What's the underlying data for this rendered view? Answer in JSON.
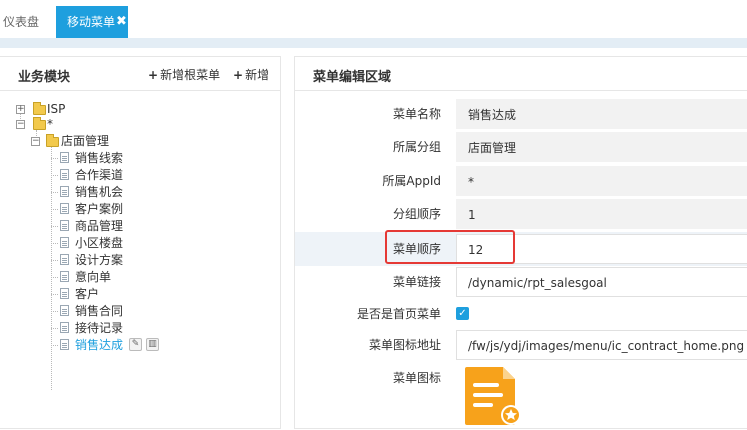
{
  "tabs": [
    {
      "label": "仪表盘",
      "active": false
    },
    {
      "label": "移动菜单",
      "active": true,
      "close": "✖"
    }
  ],
  "left_panel": {
    "title": "业务模块",
    "buttons": [
      {
        "icon": "+",
        "label": "新增根菜单"
      },
      {
        "icon": "+",
        "label": "新增"
      }
    ],
    "tree": {
      "toggle_collapsed": "+",
      "toggle_expanded": "−",
      "root_items": [
        "ISP",
        "*"
      ],
      "folder": "店面管理",
      "children": [
        "销售线索",
        "合作渠道",
        "销售机会",
        "客户案例",
        "商品管理",
        "小区楼盘",
        "设计方案",
        "意向单",
        "客户",
        "销售合同",
        "接待记录",
        "销售达成"
      ],
      "selected": "销售达成"
    }
  },
  "right_panel": {
    "title": "菜单编辑区域",
    "fields": [
      {
        "label": "菜单名称",
        "value": "销售达成"
      },
      {
        "label": "所属分组",
        "value": "店面管理"
      },
      {
        "label": "所属AppId",
        "value": "*"
      },
      {
        "label": "分组顺序",
        "value": "1"
      },
      {
        "label": "菜单顺序",
        "value": "12"
      },
      {
        "label": "菜单链接",
        "value": "/dynamic/rpt_salesgoal"
      }
    ],
    "homepage": {
      "label": "是否是首页菜单",
      "checked": true,
      "check_mark": "✓"
    },
    "icon_url": {
      "label": "菜单图标地址",
      "value": "/fw/js/ydj/images/menu/ic_contract_home.png"
    },
    "icon_label": "菜单图标"
  },
  "colors": {
    "accent": "#1e9fde",
    "highlight_border": "#e53935",
    "icon_orange": "#f7a21b"
  }
}
